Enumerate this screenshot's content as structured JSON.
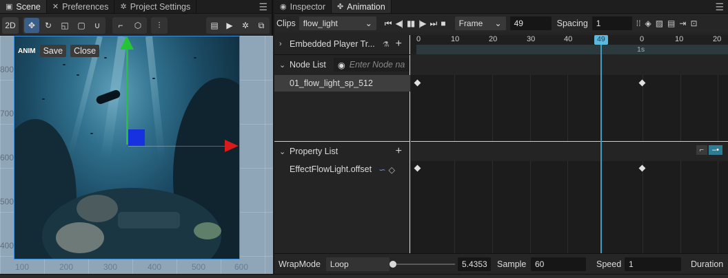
{
  "scene_panel": {
    "tabs": [
      {
        "label": "Scene",
        "icon": "scene-icon"
      },
      {
        "label": "Preferences",
        "icon": "tools-icon"
      },
      {
        "label": "Project Settings",
        "icon": "gear-icon"
      }
    ],
    "toolbar": {
      "mode_2d": "2D"
    },
    "ruler_y": [
      "800",
      "700",
      "600",
      "500",
      "400"
    ],
    "ruler_x": [
      "100",
      "200",
      "300",
      "400",
      "500",
      "600"
    ],
    "anim_overlay": {
      "tag": "ANIM",
      "save": "Save",
      "close": "Close"
    }
  },
  "anim_panel": {
    "tabs": [
      {
        "label": "Inspector",
        "icon": "inspector-icon"
      },
      {
        "label": "Animation",
        "icon": "animation-icon"
      }
    ],
    "clips_label": "Clips",
    "clip_value": "flow_light",
    "frame_mode": "Frame",
    "frame_value": "49",
    "spacing_label": "Spacing",
    "spacing_value": "1",
    "embedded_label": "Embedded Player Tr...",
    "node_list_label": "Node List",
    "node_placeholder": "Enter Node na",
    "node_item": "01_flow_light_sp_512",
    "property_list_label": "Property List",
    "property_item": "EffectFlowLight.offset",
    "ruler_labels": [
      "0",
      "10",
      "20",
      "30",
      "40",
      "0",
      "10",
      "20"
    ],
    "cursor_label": "49",
    "time_label": "1s",
    "footer": {
      "wrapmode_label": "WrapMode",
      "wrapmode_value": "Loop",
      "time_value": "5.4353",
      "sample_label": "Sample",
      "sample_value": "60",
      "speed_label": "Speed",
      "speed_value": "1",
      "duration_label": "Duration"
    }
  }
}
